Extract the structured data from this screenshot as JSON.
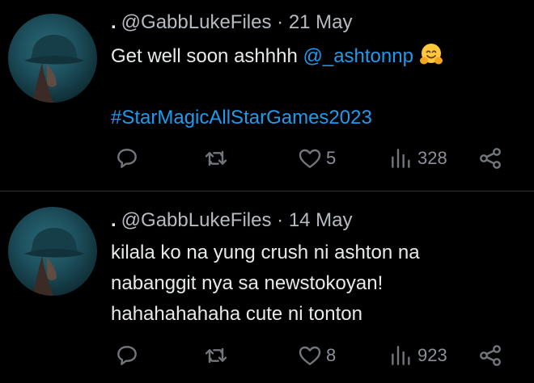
{
  "tweets": [
    {
      "prefix": ".",
      "handle": "@GabbLukeFiles",
      "separator": "·",
      "date": "21 May",
      "text_before_mention": "Get well soon ashhhh ",
      "mention": "@_ashtonnp",
      "emoji": "hugging-face-emoji",
      "hashtag": "#StarMagicAllStarGames2023",
      "likes": "5",
      "views": "328"
    },
    {
      "prefix": ".",
      "handle": "@GabbLukeFiles",
      "separator": "·",
      "date": "14 May",
      "lines": [
        "kilala ko na yung crush ni ashton na",
        "nabanggit nya sa newstokoyan!",
        "hahahahahaha cute ni tonton"
      ],
      "likes": "8",
      "views": "923"
    }
  ],
  "icons": {
    "reply": "reply-icon",
    "retweet": "retweet-icon",
    "like": "heart-icon",
    "views": "views-icon",
    "share": "share-icon"
  },
  "colors": {
    "background": "#000000",
    "text": "#e7e9ea",
    "secondary": "#71767b",
    "link": "#1d9bf0",
    "divider": "#2f3336"
  }
}
